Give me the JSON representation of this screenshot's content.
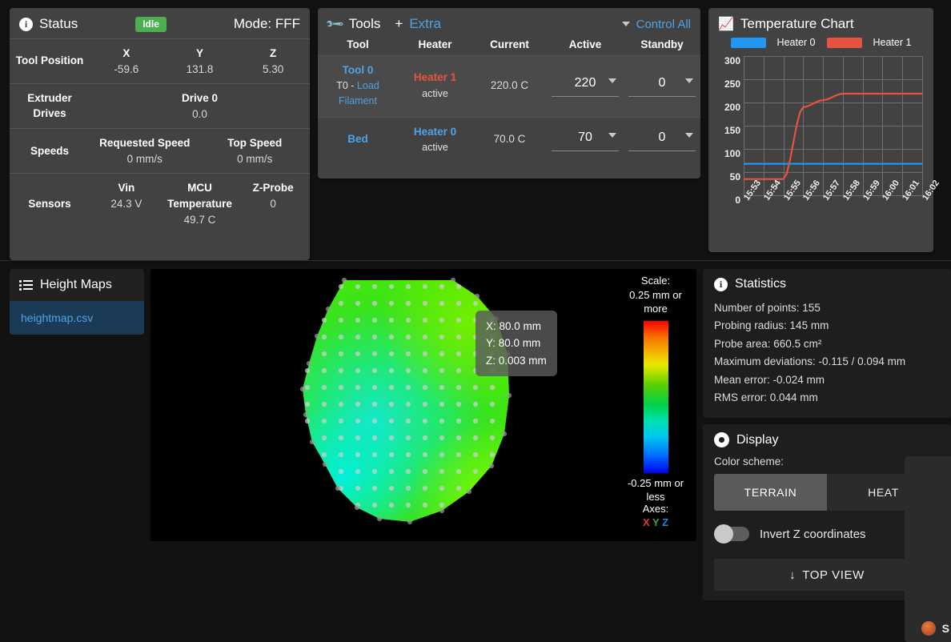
{
  "status": {
    "title": "Status",
    "icon": "info-circle-icon",
    "badge": "Idle",
    "mode": "Mode: FFF",
    "rows": [
      {
        "label": "Tool Position",
        "cells": [
          {
            "k": "X",
            "v": "-59.6"
          },
          {
            "k": "Y",
            "v": "131.8"
          },
          {
            "k": "Z",
            "v": "5.30"
          }
        ]
      },
      {
        "label": "Extruder Drives",
        "cells": [
          {
            "k": "Drive 0",
            "v": "0.0"
          }
        ]
      },
      {
        "label": "Speeds",
        "cells": [
          {
            "k": "Requested Speed",
            "v": "0 mm/s"
          },
          {
            "k": "Top Speed",
            "v": "0 mm/s"
          }
        ]
      },
      {
        "label": "Sensors",
        "cells": [
          {
            "k": "Vin",
            "v": "24.3 V"
          },
          {
            "k": "MCU Temperature",
            "v": "49.7 C"
          },
          {
            "k": "Z-Probe",
            "v": "0"
          }
        ]
      }
    ]
  },
  "tools": {
    "title": "Tools",
    "icon": "wrench-icon",
    "plus": "+",
    "extra_link": "Extra",
    "control_all": "Control All",
    "columns": [
      "Tool",
      "Heater",
      "Current",
      "Active",
      "Standby"
    ],
    "rows": [
      {
        "tool_name": "Tool 0",
        "tool_sub_prefix": "T0 - ",
        "tool_sub_link": "Load Filament",
        "heater": "Heater 1",
        "heater_color": "#e8533f",
        "heater_state": "active",
        "current": "220.0 C",
        "active": "220",
        "standby": "0"
      },
      {
        "tool_name": "Bed",
        "tool_sub_prefix": "",
        "tool_sub_link": "",
        "heater": "Heater 0",
        "heater_color": "#4da3e8",
        "heater_state": "active",
        "current": "70.0 C",
        "active": "70",
        "standby": "0"
      }
    ]
  },
  "chart": {
    "title": "Temperature Chart",
    "icon": "chart-line-icon"
  },
  "chart_data": {
    "type": "line",
    "title": "Temperature Chart",
    "xlabel": "",
    "ylabel": "",
    "ylim": [
      0,
      300
    ],
    "yticks": [
      0,
      50,
      100,
      150,
      200,
      250,
      300
    ],
    "x": [
      "15:53",
      "15:54",
      "15:55",
      "15:56",
      "15:57",
      "15:58",
      "15:59",
      "16:00",
      "16:01",
      "16:02"
    ],
    "grid": true,
    "legend_position": "top",
    "series": [
      {
        "name": "Heater 0",
        "color": "#2196f3",
        "values": [
          68,
          68,
          68,
          68,
          68,
          68,
          68,
          68,
          68,
          68
        ]
      },
      {
        "name": "Heater 1",
        "color": "#e8533f",
        "values": [
          35,
          35,
          35,
          190,
          205,
          219,
          219,
          219,
          219,
          219
        ]
      }
    ]
  },
  "heightmaps": {
    "title": "Height Maps",
    "icon": "list-icon",
    "files": [
      {
        "name": "heightmap.csv",
        "selected": true
      }
    ]
  },
  "heightmap_view": {
    "tooltip": {
      "x": "X: 80.0 mm",
      "y": "Y: 80.0 mm",
      "z": "Z: 0.003 mm"
    },
    "scale": {
      "label": "Scale:",
      "max": "0.25 mm or more",
      "min": "-0.25 mm or less"
    },
    "axes": {
      "label": "Axes:",
      "x": "X",
      "y": "Y",
      "z": "Z"
    }
  },
  "statistics": {
    "title": "Statistics",
    "icon": "info-circle-icon",
    "lines": [
      "Number of points: 155",
      "Probing radius: 145 mm",
      "Probe area: 660.5 cm²",
      "Maximum deviations: -0.115 / 0.094 mm",
      "Mean error: -0.024 mm",
      "RMS error: 0.044 mm"
    ]
  },
  "display": {
    "title": "Display",
    "icon": "eye-icon",
    "color_scheme_label": "Color scheme:",
    "schemes": [
      {
        "label": "TERRAIN",
        "selected": true
      },
      {
        "label": "HEAT",
        "selected": false
      }
    ],
    "invert_label": "Invert Z coordinates",
    "invert_on": false,
    "top_view_label": "TOP VIEW",
    "top_view_icon": "download-arrow-icon"
  },
  "overlay": {
    "badge_letter": "S",
    "icon": "app-icon"
  },
  "colors": {
    "page_bg": "#121212",
    "panel_bg": "#424242",
    "card_bg": "#1e1e1e",
    "accent_blue": "#4da3e8",
    "accent_red": "#e8533f",
    "idle_green": "#4caf50"
  }
}
